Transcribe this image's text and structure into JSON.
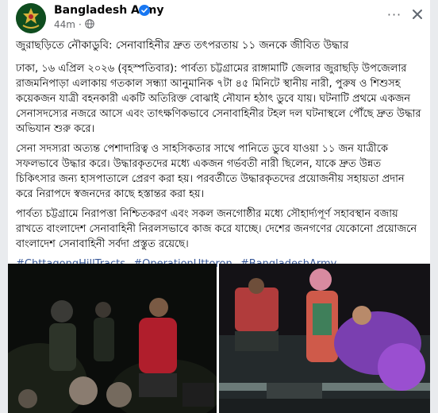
{
  "post": {
    "page_name": "Bangladesh Army",
    "time": "44m",
    "dot": "·",
    "more_label": "···",
    "title": "জুরাছড়িতে নৌকাডুবি: সেনাবাহিনীর দ্রুত তৎপরতায় ১১ জনকে জীবিত উদ্ধার",
    "paragraphs": [
      "ঢাকা, ১৬ এপ্রিল ২০২৬ (বৃহস্পতিবার): পার্বত্য চট্টগ্রামের রাঙ্গামাটি জেলার জুরাছড়ি উপজেলার রাজমনিপাড়া এলাকায় গতকাল সন্ধ্যা আনুমানিক ৭টা ৪৫ মিনিটে স্থানীয় নারী, পুরুষ ও শিশুসহ কয়েকজন যাত্রী বহনকারী একটি অতিরিক্ত বোঝাই নৌযান হঠাৎ ডুবে যায়। ঘটনাটি প্রথমে একজন সেনাসদস্যের নজরে আসে এবং তাৎক্ষণিকভাবে সেনাবাহিনীর টহল দল ঘটনাস্থলে পৌঁছে দ্রুত উদ্ধার অভিযান শুরু করে।",
      "সেনা সদস্যরা অত্যন্ত পেশাদারিত্ব ও সাহসিকতার সাথে পানিতে ডুবে যাওয়া ১১ জন যাত্রীকে সফলভাবে উদ্ধার করে। উদ্ধারকৃতদের মধ্যে একজন গর্ভবতী নারী ছিলেন, যাকে দ্রুত উন্নত চিকিৎসার জন্য হাসপাতালে প্রেরণ করা হয়। পরবর্তীতে উদ্ধারকৃতদের প্রয়োজনীয় সহায়তা প্রদান করে নিরাপদে স্বজনদের কাছে হস্তান্তর করা হয়।",
      "পার্বত্য চট্টগ্রামে নিরাপত্তা নিশ্চিতকরণ এবং সকল জনগোষ্ঠীর মধ্যে সৌহার্দ্যপূর্ণ সহাবস্থান বজায় রাখতে বাংলাদেশ সেনাবাহিনী নিরলসভাবে কাজ করে যাচ্ছে। দেশের জনগণের যেকোনো প্রয়োজনে বাংলাদেশ সেনাবাহিনী সর্বদা প্রস্তুত রয়েছে।"
    ],
    "hashtags": [
      "#ChttagongHillTracts",
      "#OperationUttoron",
      "#BangladeshArmy"
    ]
  },
  "colors": {
    "link": "#385898",
    "verified": "#1877f2",
    "secondary_text": "#65676b",
    "avatar_bg": "#0f4d1f"
  },
  "icons": {
    "avatar": "army-emblem-icon",
    "verified": "verified-badge-icon",
    "privacy": "globe-icon",
    "more": "more-options-icon",
    "close": "close-icon"
  }
}
